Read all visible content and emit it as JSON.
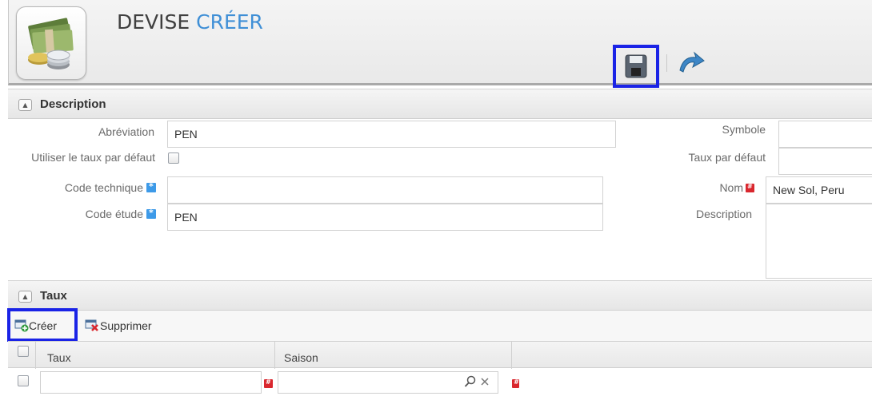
{
  "header": {
    "title_main": "DEVISE",
    "title_action": "CRÉER",
    "icon": "money-stack-icon"
  },
  "toolbar": {
    "save_icon": "floppy-disk-icon",
    "back_icon": "back-arrow-icon"
  },
  "description_section": {
    "title": "Description",
    "fields": {
      "abreviation": {
        "label": "Abréviation",
        "value": "PEN"
      },
      "utiliser_taux": {
        "label": "Utiliser le taux par défaut",
        "checked": false
      },
      "code_technique": {
        "label": "Code technique",
        "value": ""
      },
      "code_etude": {
        "label": "Code étude",
        "value": "PEN"
      },
      "symbole": {
        "label": "Symbole",
        "value": ""
      },
      "taux_defaut": {
        "label": "Taux par défaut",
        "value": ""
      },
      "nom": {
        "label": "Nom",
        "value": "New Sol, Peru"
      },
      "description": {
        "label": "Description",
        "value": ""
      }
    }
  },
  "taux_section": {
    "title": "Taux",
    "creer_label": "Créer",
    "supprimer_label": "Supprimer",
    "columns": [
      "Taux",
      "Saison"
    ],
    "row": {
      "taux": "",
      "saison": ""
    }
  },
  "colors": {
    "accent": "#3f8fd6",
    "required": "#d9272e",
    "info": "#3d9ae8",
    "highlight": "#1a23e6"
  }
}
